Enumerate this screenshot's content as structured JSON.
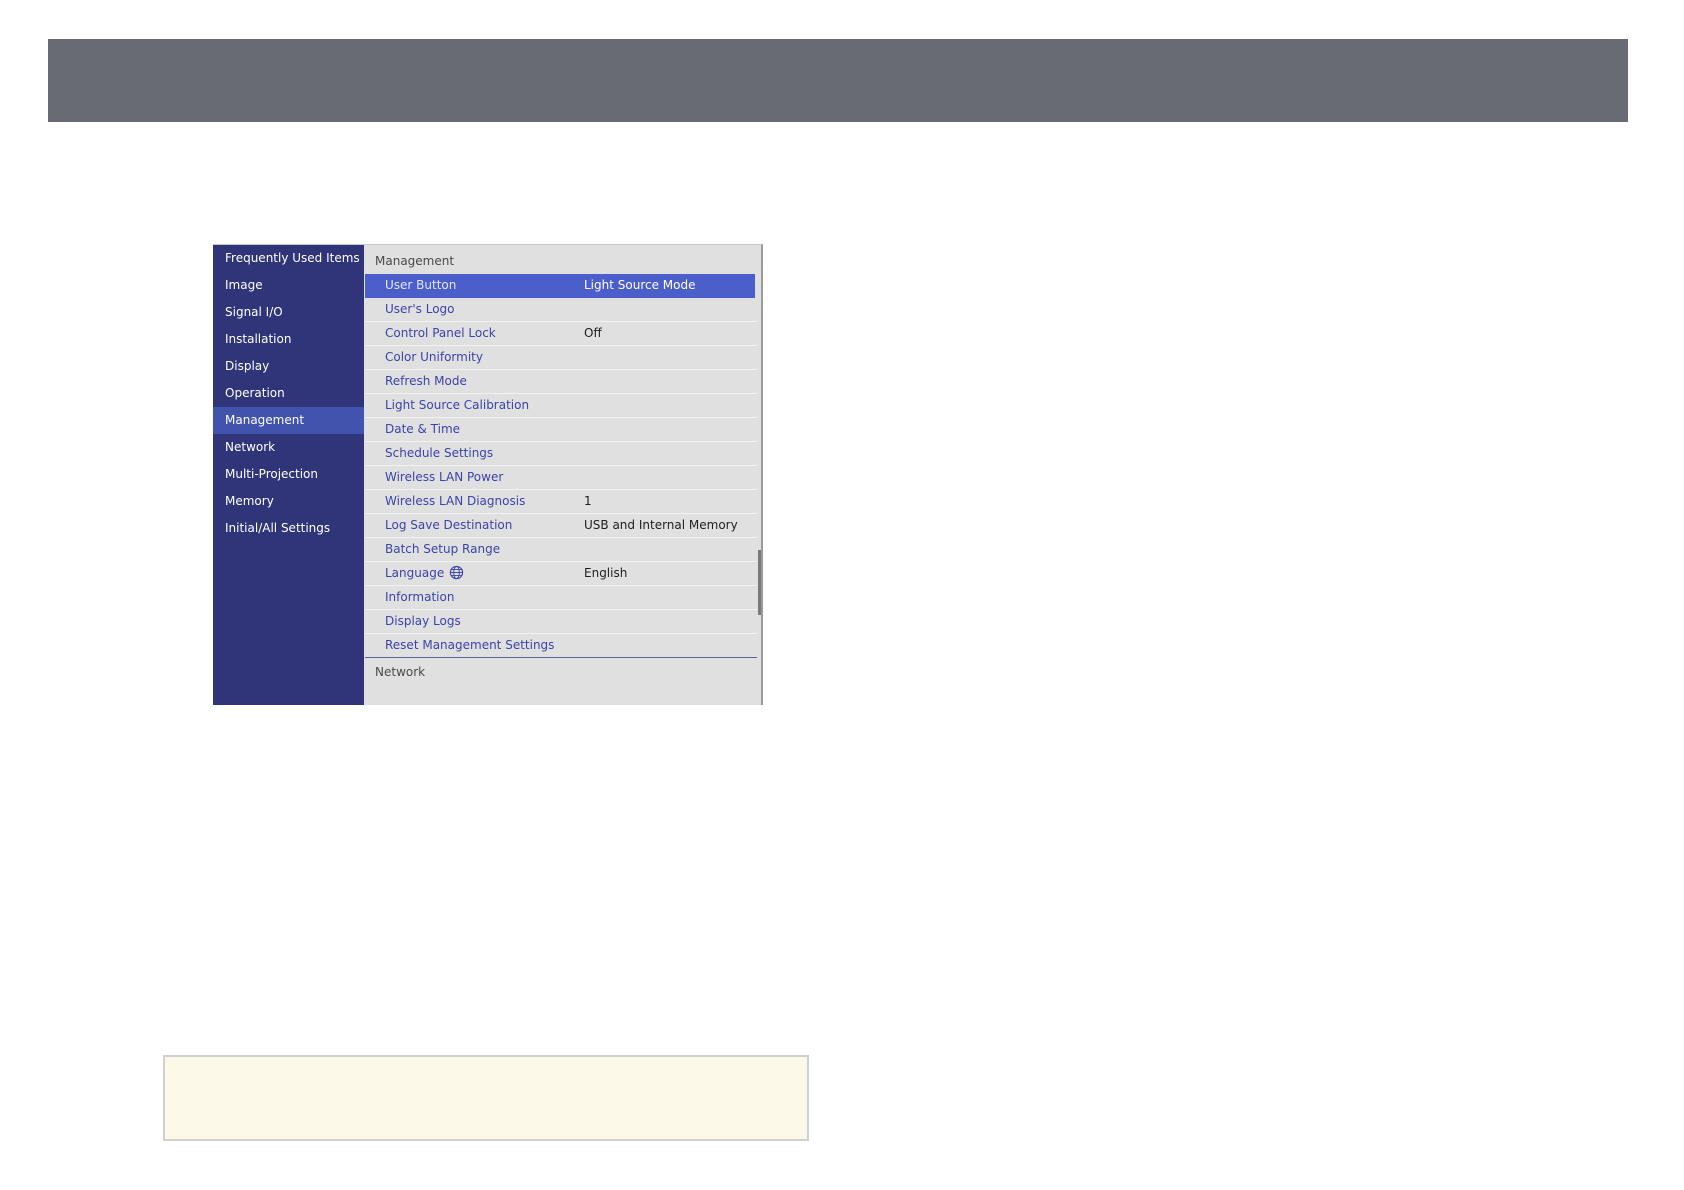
{
  "sidebar": {
    "items": [
      {
        "label": "Frequently Used Items"
      },
      {
        "label": "Image"
      },
      {
        "label": "Signal I/O"
      },
      {
        "label": "Installation"
      },
      {
        "label": "Display"
      },
      {
        "label": "Operation"
      },
      {
        "label": "Management"
      },
      {
        "label": "Network"
      },
      {
        "label": "Multi-Projection"
      },
      {
        "label": "Memory"
      },
      {
        "label": "Initial/All Settings"
      }
    ],
    "active_index": 6
  },
  "panel": {
    "section_title": "Management",
    "rows": [
      {
        "label": "User Button",
        "value": "Light Source Mode"
      },
      {
        "label": "User's Logo",
        "value": ""
      },
      {
        "label": "Control Panel Lock",
        "value": "Off"
      },
      {
        "label": "Color Uniformity",
        "value": ""
      },
      {
        "label": "Refresh Mode",
        "value": ""
      },
      {
        "label": "Light Source Calibration",
        "value": ""
      },
      {
        "label": "Date & Time",
        "value": ""
      },
      {
        "label": "Schedule Settings",
        "value": ""
      },
      {
        "label": "Wireless LAN Power",
        "value": ""
      },
      {
        "label": "Wireless LAN Diagnosis",
        "value": "1"
      },
      {
        "label": "Log Save Destination",
        "value": "USB and Internal Memory"
      },
      {
        "label": "Batch Setup Range",
        "value": ""
      },
      {
        "label": "Language",
        "value": "English",
        "icon": "globe-icon"
      },
      {
        "label": "Information",
        "value": ""
      },
      {
        "label": "Display Logs",
        "value": ""
      },
      {
        "label": "Reset Management Settings",
        "value": ""
      }
    ],
    "next_section_title": "Network"
  },
  "colors": {
    "banner": "#686b74",
    "sidebar_bg": "#2f3578",
    "sidebar_active": "#4253ad",
    "row_selected": "#4c5ec9",
    "row_label": "#3b44a8",
    "note_bg": "#fdf9e8"
  }
}
